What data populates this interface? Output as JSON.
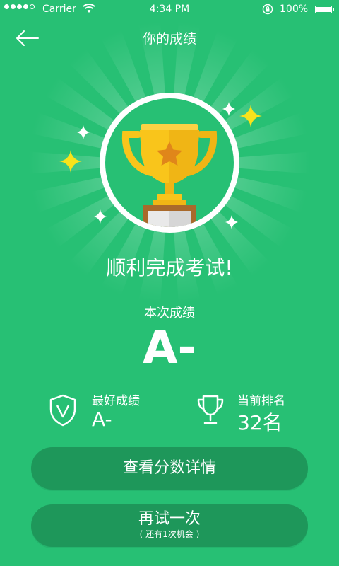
{
  "status_bar": {
    "carrier": "Carrier",
    "time": "4:34 PM",
    "battery": "100%"
  },
  "nav": {
    "title": "你的成绩"
  },
  "result": {
    "headline": "顺利完成考试!",
    "score_label": "本次成绩",
    "score": "A-"
  },
  "stats": {
    "best_label": "最好成绩",
    "best_value": "A-",
    "rank_label": "当前排名",
    "rank_value": "32名"
  },
  "buttons": {
    "detail_label": "查看分数详情",
    "retry_label": "再试一次",
    "retry_sub": "( 还有1次机会 )"
  },
  "colors": {
    "background": "#27c074",
    "button": "#1e975a",
    "trophy_gold": "#f9c51b",
    "trophy_base": "#a9692b"
  },
  "icons": {
    "back": "arrow-left-icon",
    "trophy": "trophy-icon",
    "shield": "shield-v-icon",
    "rank": "trophy-outline-icon",
    "sparkle": "sparkle-icon"
  }
}
